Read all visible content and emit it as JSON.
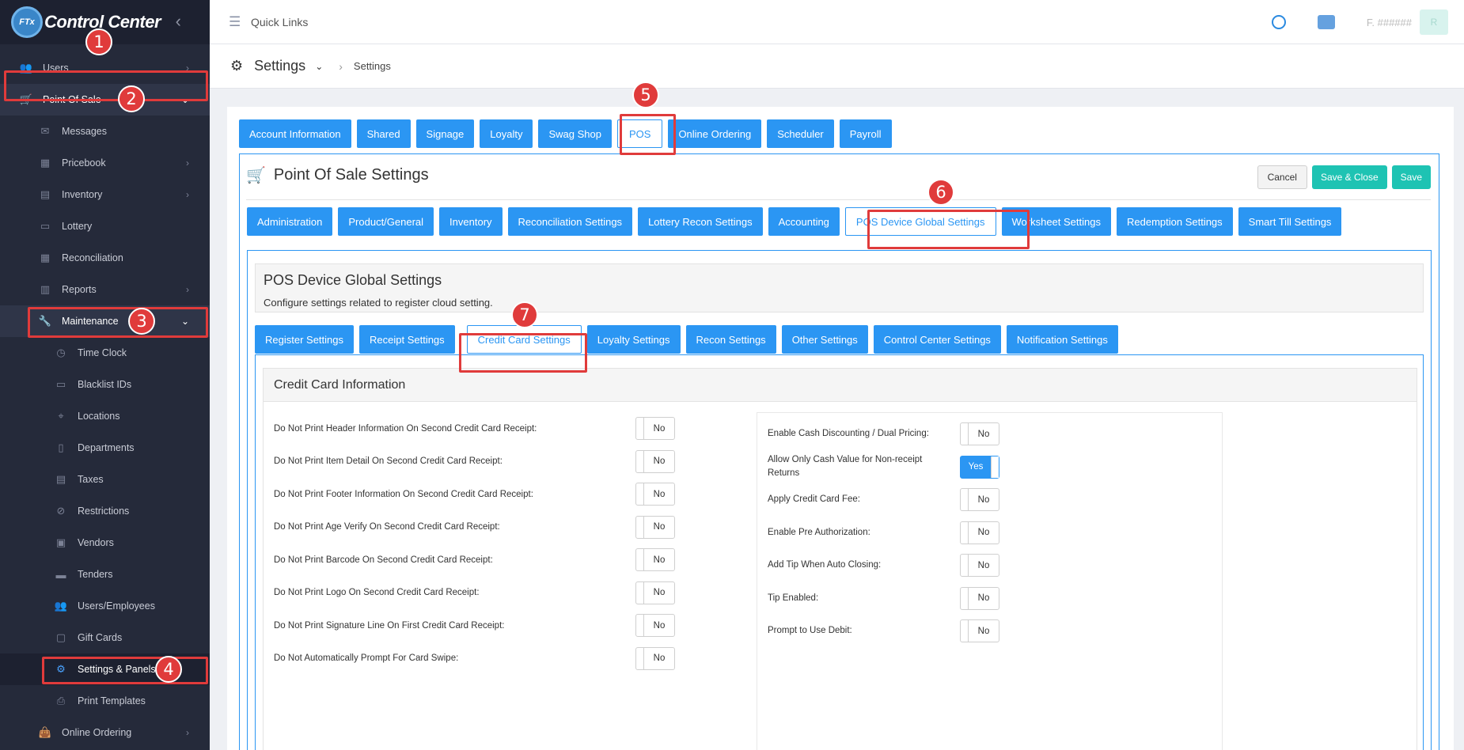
{
  "brand": {
    "logo_text": "FTx",
    "name": "Control Center"
  },
  "sidebar": {
    "items": [
      {
        "label": "Users"
      },
      {
        "label": "Point Of Sale"
      },
      {
        "label": "Messages"
      },
      {
        "label": "Pricebook"
      },
      {
        "label": "Inventory"
      },
      {
        "label": "Lottery"
      },
      {
        "label": "Reconciliation"
      },
      {
        "label": "Reports"
      },
      {
        "label": "Maintenance"
      },
      {
        "label": "Time Clock"
      },
      {
        "label": "Blacklist IDs"
      },
      {
        "label": "Locations"
      },
      {
        "label": "Departments"
      },
      {
        "label": "Taxes"
      },
      {
        "label": "Restrictions"
      },
      {
        "label": "Vendors"
      },
      {
        "label": "Tenders"
      },
      {
        "label": "Users/Employees"
      },
      {
        "label": "Gift Cards"
      },
      {
        "label": "Settings & Panels"
      },
      {
        "label": "Print Templates"
      },
      {
        "label": "Online Ordering"
      }
    ]
  },
  "topbar": {
    "quick_links": "Quick Links",
    "user_name": "F. ######",
    "avatar_text": "R"
  },
  "breadcrumb": {
    "title": "Settings",
    "current": "Settings"
  },
  "main_tabs": [
    "Account Information",
    "Shared",
    "Signage",
    "Loyalty",
    "Swag Shop",
    "POS",
    "Online Ordering",
    "Scheduler",
    "Payroll"
  ],
  "pos": {
    "title": "Point Of Sale Settings",
    "cancel": "Cancel",
    "save_close": "Save & Close",
    "save": "Save",
    "tabs": [
      "Administration",
      "Product/General",
      "Inventory",
      "Reconciliation Settings",
      "Lottery Recon Settings",
      "Accounting",
      "POS Device Global Settings",
      "Worksheet Settings",
      "Redemption Settings",
      "Smart Till Settings"
    ]
  },
  "device": {
    "title": "POS Device Global Settings",
    "description": "Configure settings related to register cloud setting.",
    "tabs": [
      "Register Settings",
      "Receipt Settings",
      "Credit Card Settings",
      "Loyalty Settings",
      "Recon Settings",
      "Other Settings",
      "Control Center Settings",
      "Notification Settings"
    ]
  },
  "credit_card": {
    "title": "Credit Card Information",
    "left": [
      {
        "label": "Do Not Print Header Information On Second Credit Card Receipt:",
        "value": "No"
      },
      {
        "label": "Do Not Print Item Detail On Second Credit Card Receipt:",
        "value": "No"
      },
      {
        "label": "Do Not Print Footer Information On Second Credit Card Receipt:",
        "value": "No"
      },
      {
        "label": "Do Not Print Age Verify On Second Credit Card Receipt:",
        "value": "No"
      },
      {
        "label": "Do Not Print Barcode On Second Credit Card Receipt:",
        "value": "No"
      },
      {
        "label": "Do Not Print Logo On Second Credit Card Receipt:",
        "value": "No"
      },
      {
        "label": "Do Not Print Signature Line On First Credit Card Receipt:",
        "value": "No"
      },
      {
        "label": "Do Not Automatically Prompt For Card Swipe:",
        "value": "No"
      }
    ],
    "right": [
      {
        "label": "Enable Cash Discounting / Dual Pricing:",
        "value": "No"
      },
      {
        "label": "Allow Only Cash Value for Non-receipt Returns",
        "value": "Yes"
      },
      {
        "label": "Apply Credit Card Fee:",
        "value": "No"
      },
      {
        "label": "Enable Pre Authorization:",
        "value": "No"
      },
      {
        "label": "Add Tip When Auto Closing:",
        "value": "No"
      },
      {
        "label": "Tip Enabled:",
        "value": "No"
      },
      {
        "label": "Prompt to Use Debit:",
        "value": "No"
      }
    ]
  },
  "annotations": [
    "1",
    "2",
    "3",
    "4",
    "5",
    "6",
    "7"
  ]
}
